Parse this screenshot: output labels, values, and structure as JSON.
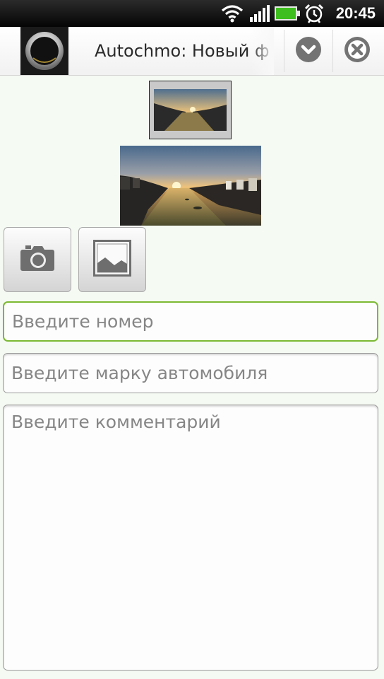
{
  "status_bar": {
    "time": "20:45",
    "icons": [
      "wifi-icon",
      "signal-icon",
      "battery-icon",
      "alarm-icon"
    ]
  },
  "title_bar": {
    "title": "Autochmo: Новый ф",
    "icons": [
      "app-logo-icon",
      "chevron-down-icon",
      "close-icon"
    ]
  },
  "buttons": {
    "camera_icon": "camera-icon",
    "gallery_icon": "gallery-icon"
  },
  "form": {
    "number_placeholder": "Введите номер",
    "brand_placeholder": "Введите марку автомобиля",
    "comment_placeholder": "Введите комментарий"
  },
  "colors": {
    "focus_border": "#7cb933",
    "background": "#f5faf3"
  }
}
